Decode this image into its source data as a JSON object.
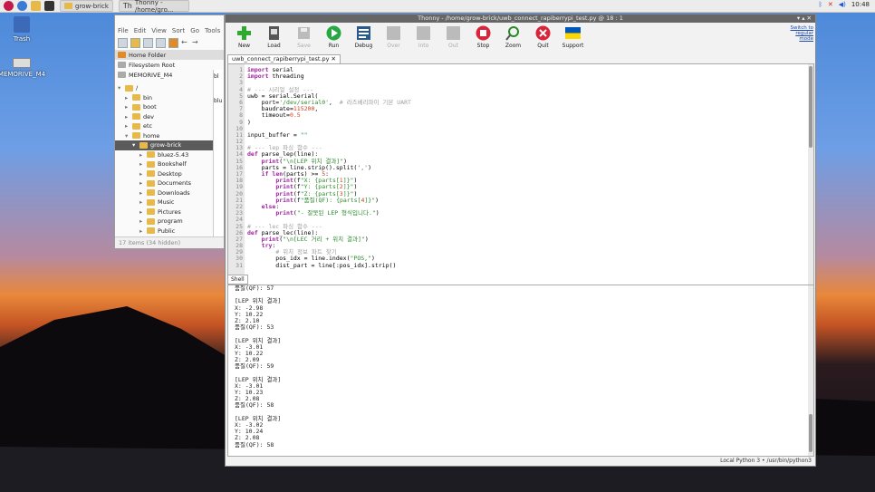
{
  "taskbar": {
    "tasks": [
      {
        "label": "grow-brick"
      },
      {
        "label": "Thonny - /home/gro..."
      }
    ],
    "clock": "10:48"
  },
  "desktop": {
    "icons": [
      {
        "label": "Trash"
      },
      {
        "label": "MEMORIVE_M4"
      }
    ]
  },
  "file_manager": {
    "menu": [
      "File",
      "Edit",
      "View",
      "Sort",
      "Go",
      "Tools"
    ],
    "places": [
      {
        "label": "Home Folder"
      },
      {
        "label": "Filesystem Root"
      },
      {
        "label": "MEMORIVE_M4"
      }
    ],
    "tree": [
      {
        "label": "/",
        "depth": 0
      },
      {
        "label": "bin",
        "depth": 1
      },
      {
        "label": "boot",
        "depth": 1
      },
      {
        "label": "dev",
        "depth": 1
      },
      {
        "label": "etc",
        "depth": 1
      },
      {
        "label": "home",
        "depth": 1
      },
      {
        "label": "grow-brick",
        "depth": 2
      },
      {
        "label": "bluez-5.43",
        "depth": 3
      },
      {
        "label": "Bookshelf",
        "depth": 3
      },
      {
        "label": "Desktop",
        "depth": 3
      },
      {
        "label": "Documents",
        "depth": 3
      },
      {
        "label": "Downloads",
        "depth": 3
      },
      {
        "label": "Music",
        "depth": 3
      },
      {
        "label": "Pictures",
        "depth": 3
      },
      {
        "label": "program",
        "depth": 3
      },
      {
        "label": "Public",
        "depth": 3
      }
    ],
    "side_items": [
      "bl",
      "blu"
    ],
    "status": "17 items (34 hidden)"
  },
  "thonny": {
    "title": "Thonny - /home/grow-brick/uwb_connect_rapiberrypi_test.py @ 18 : 1",
    "toolbar": [
      {
        "label": "New",
        "icon": "new-icon",
        "enabled": true,
        "color": "#2eaa2e"
      },
      {
        "label": "Load",
        "icon": "load-icon",
        "enabled": true,
        "color": "#444"
      },
      {
        "label": "Save",
        "icon": "save-icon",
        "enabled": false,
        "color": "#999"
      },
      {
        "label": "Run",
        "icon": "run-icon",
        "enabled": true,
        "color": "#28a745"
      },
      {
        "label": "Debug",
        "icon": "debug-icon",
        "enabled": true,
        "color": "#2a5a8a"
      },
      {
        "label": "Over",
        "icon": "over-icon",
        "enabled": false,
        "color": "#999"
      },
      {
        "label": "Into",
        "icon": "into-icon",
        "enabled": false,
        "color": "#999"
      },
      {
        "label": "Out",
        "icon": "out-icon",
        "enabled": false,
        "color": "#999"
      },
      {
        "label": "Stop",
        "icon": "stop-icon",
        "enabled": true,
        "color": "#d9243a"
      },
      {
        "label": "Zoom",
        "icon": "zoom-icon",
        "enabled": true,
        "color": "#2a8a2a"
      },
      {
        "label": "Quit",
        "icon": "quit-icon",
        "enabled": true,
        "color": "#d9243a"
      },
      {
        "label": "Support",
        "icon": "support-icon",
        "enabled": true,
        "color": "#0057b7"
      }
    ],
    "switch_mode": [
      "Switch to",
      "regular",
      "mode"
    ],
    "editor_tab": "uwb_connect_rapiberrypi_test.py",
    "code": [
      "import serial",
      "import threading",
      "",
      "# --- 시리얼 설정 ---",
      "uwb = serial.Serial(",
      "    port='/dev/serial0',  # 라즈베리파이 기본 UART",
      "    baudrate=115200,",
      "    timeout=0.5",
      ")",
      "",
      "input_buffer = \"\"",
      "",
      "# --- lep 파싱 함수 ---",
      "def parse_lep(line):",
      "    print(\"\\n[LEP 위치 결과]\")",
      "    parts = line.strip().split(',')",
      "    if len(parts) >= 5:",
      "        print(f\"X: {parts[1]}\")",
      "        print(f\"Y: {parts[2]}\")",
      "        print(f\"Z: {parts[3]}\")",
      "        print(f\"품질(QF): {parts[4]}\")",
      "    else:",
      "        print(\"- 잘못된 LEP 형식입니다.\")",
      "",
      "# --- lec 파싱 함수 ---",
      "def parse_lec(line):",
      "    print(\"\\n[LEC 거리 + 위치 결과]\")",
      "    try:",
      "        # 위치 정보 파트 찾기",
      "        pos_idx = line.index(\"POS,\")",
      "        dist_part = line[:pos_idx].strip()"
    ],
    "shell_tab": "Shell",
    "shell": [
      "품질(QF): 57",
      "",
      "[LEP 위치 결과]",
      "X: -2.98",
      "Y: 10.22",
      "Z: 2.10",
      "품질(QF): 53",
      "",
      "[LEP 위치 결과]",
      "X: -3.01",
      "Y: 10.22",
      "Z: 2.09",
      "품질(QF): 59",
      "",
      "[LEP 위치 결과]",
      "X: -3.01",
      "Y: 10.23",
      "Z: 2.08",
      "품질(QF): 58",
      "",
      "[LEP 위치 결과]",
      "X: -3.02",
      "Y: 10.24",
      "Z: 2.08",
      "품질(QF): 58"
    ],
    "status": "Local Python 3 • /usr/bin/python3"
  }
}
